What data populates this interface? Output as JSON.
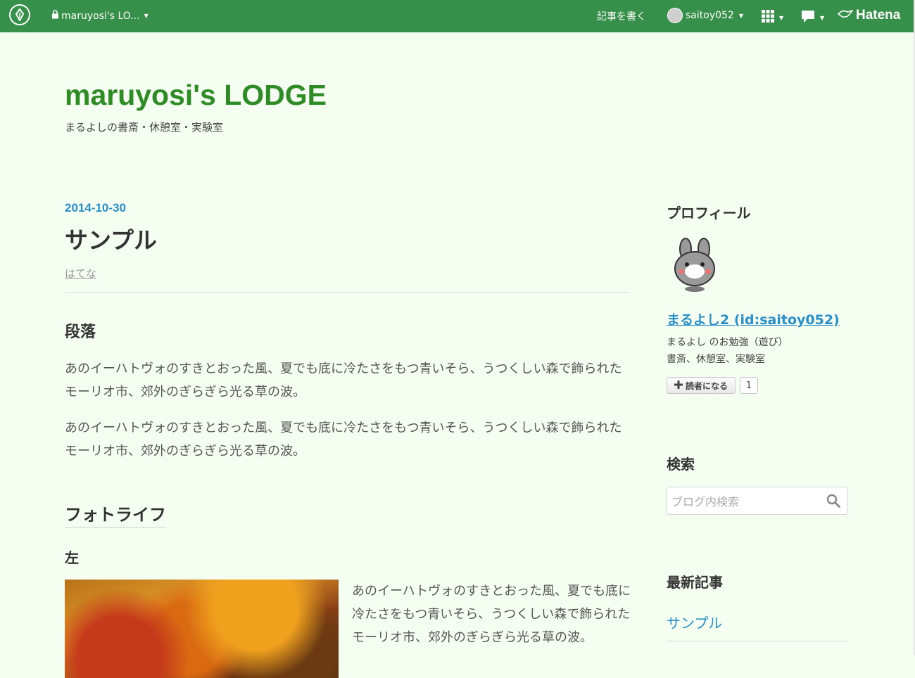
{
  "topbar": {
    "blog_selector": "maruyosi's LO...",
    "write_label": "記事を書く",
    "username": "saitoy052",
    "brand": "Hatena"
  },
  "blog": {
    "title": "maruyosi's LODGE",
    "description": "まるよしの書斎・休憩室・実験室"
  },
  "entry": {
    "date": "2014-10-30",
    "title": "サンプル",
    "category": "はてな",
    "sections": [
      {
        "heading": "段落",
        "paragraphs": [
          "あのイーハトヴォのすきとおった風、夏でも底に冷たさをもつ青いそら、うつくしい森で飾られたモーリオ市、郊外のぎらぎら光る草の波。",
          "あのイーハトヴォのすきとおった風、夏でも底に冷たさをもつ青いそら、うつくしい森で飾られたモーリオ市、郊外のぎらぎら光る草の波。"
        ]
      },
      {
        "heading": "フォトライフ",
        "subheading": "左",
        "photo_text": "あのイーハトヴォのすきとおった風、夏でも底に冷たさをもつ青いそら、うつくしい森で飾られたモーリオ市、郊外のぎらぎら光る草の波。"
      }
    ]
  },
  "sidebar": {
    "profile": {
      "heading": "プロフィール",
      "name": "まるよし2 (id:saitoy052)",
      "desc_line1": "まるよし のお勉強（遊び）",
      "desc_line2": "書斎、休憩室、実験室",
      "subscribe_label": "読者になる",
      "subscriber_count": "1"
    },
    "search": {
      "heading": "検索",
      "placeholder": "ブログ内検索"
    },
    "recent": {
      "heading": "最新記事",
      "items": [
        "サンプル"
      ]
    }
  },
  "colors": {
    "topbar_bg": "#37904a",
    "page_bg": "#f5fff1",
    "title_green": "#2e8b25",
    "link_blue": "#2a8ec8"
  }
}
